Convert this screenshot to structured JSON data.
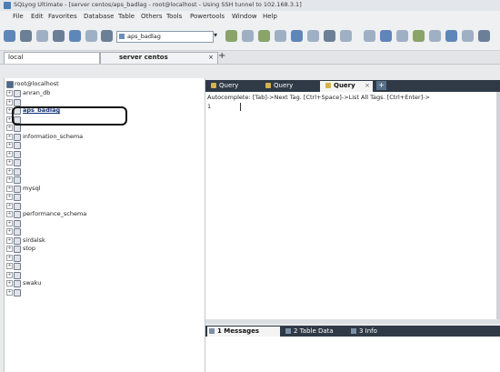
{
  "window": {
    "title": "SQLyog Ultimate - [server centos/aps_badlag - root@localhost - Using SSH tunnel to 102.168.3.1]"
  },
  "menu": [
    "File",
    "Edit",
    "Favorites",
    "Database",
    "Table",
    "Others",
    "Tools",
    "Powertools",
    "Window",
    "Help"
  ],
  "toolbar": {
    "database_selector": "aps_badlag"
  },
  "connection_tabs": [
    {
      "label": "local"
    },
    {
      "label": "server centos",
      "close": "×"
    }
  ],
  "add_tab_label": "+",
  "object_browser": {
    "root": "root@localhost",
    "databases": [
      {
        "label": "anran_db"
      },
      {
        "label": ""
      },
      {
        "label": "aps_badlag",
        "highlighted": true
      },
      {
        "label": ""
      },
      {
        "label": ""
      },
      {
        "label": "information_schema"
      },
      {
        "label": ""
      },
      {
        "label": ""
      },
      {
        "label": ""
      },
      {
        "label": ""
      },
      {
        "label": ""
      },
      {
        "label": "mysql"
      },
      {
        "label": ""
      },
      {
        "label": ""
      },
      {
        "label": "performance_schema"
      },
      {
        "label": ""
      },
      {
        "label": ""
      },
      {
        "label": "sirdalsk"
      },
      {
        "label": "stop"
      },
      {
        "label": ""
      },
      {
        "label": ""
      },
      {
        "label": ""
      },
      {
        "label": "swaku"
      },
      {
        "label": ""
      }
    ],
    "expand_glyph": "+"
  },
  "query_tabs": [
    {
      "label": "Query"
    },
    {
      "label": "Query"
    },
    {
      "label": "Query",
      "active": true,
      "close": "×"
    }
  ],
  "query_add": "+",
  "editor": {
    "autocomplete_hint": "Autocomplete: [Tab]->Next Tag. [Ctrl+Space]->List All Tags. [Ctrl+Enter]->",
    "line_number": "1"
  },
  "result_tabs": [
    {
      "label": "1 Messages",
      "active": true
    },
    {
      "label": "2 Table Data"
    },
    {
      "label": "3 Info"
    }
  ],
  "colors": {
    "tab_bar_dark": "#2f3a46",
    "highlight_border": "#111111",
    "link_blue": "#10307a"
  }
}
